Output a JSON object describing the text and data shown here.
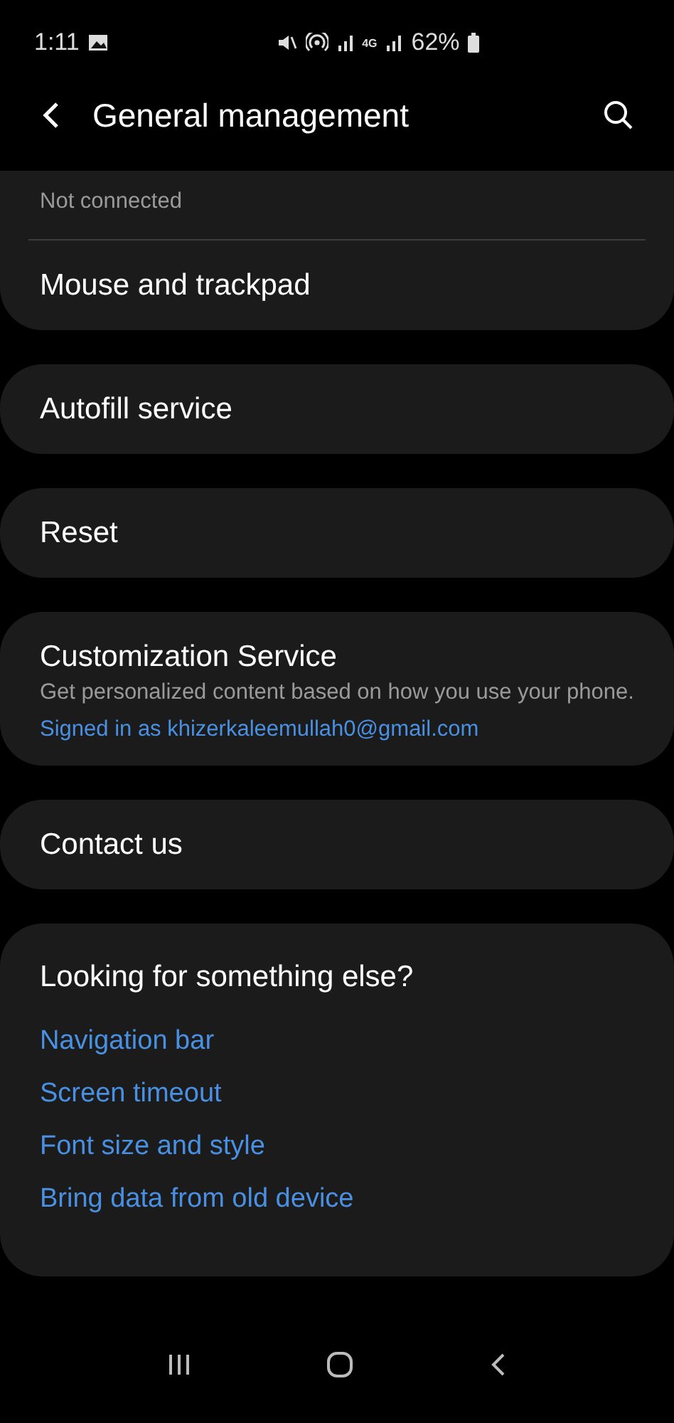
{
  "status_bar": {
    "time": "1:11",
    "network": "4G",
    "battery": "62%"
  },
  "header": {
    "title": "General management"
  },
  "cards": [
    {
      "items": [
        {
          "kind": "subtitle_only",
          "subtitle": "Not connected"
        },
        {
          "kind": "plain",
          "title": "Mouse and trackpad"
        }
      ]
    },
    {
      "items": [
        {
          "kind": "plain",
          "title": "Autofill service"
        }
      ]
    },
    {
      "items": [
        {
          "kind": "plain",
          "title": "Reset"
        }
      ]
    },
    {
      "items": [
        {
          "kind": "detailed",
          "title": "Customization Service",
          "subtitle": "Get personalized content based on how you use your phone.",
          "link": "Signed in as khizerkaleemullah0@gmail.com"
        }
      ]
    },
    {
      "items": [
        {
          "kind": "plain",
          "title": "Contact us"
        }
      ]
    }
  ],
  "suggestions": {
    "title": "Looking for something else?",
    "links": [
      "Navigation bar",
      "Screen timeout",
      "Font size and style",
      "Bring data from old device"
    ]
  }
}
